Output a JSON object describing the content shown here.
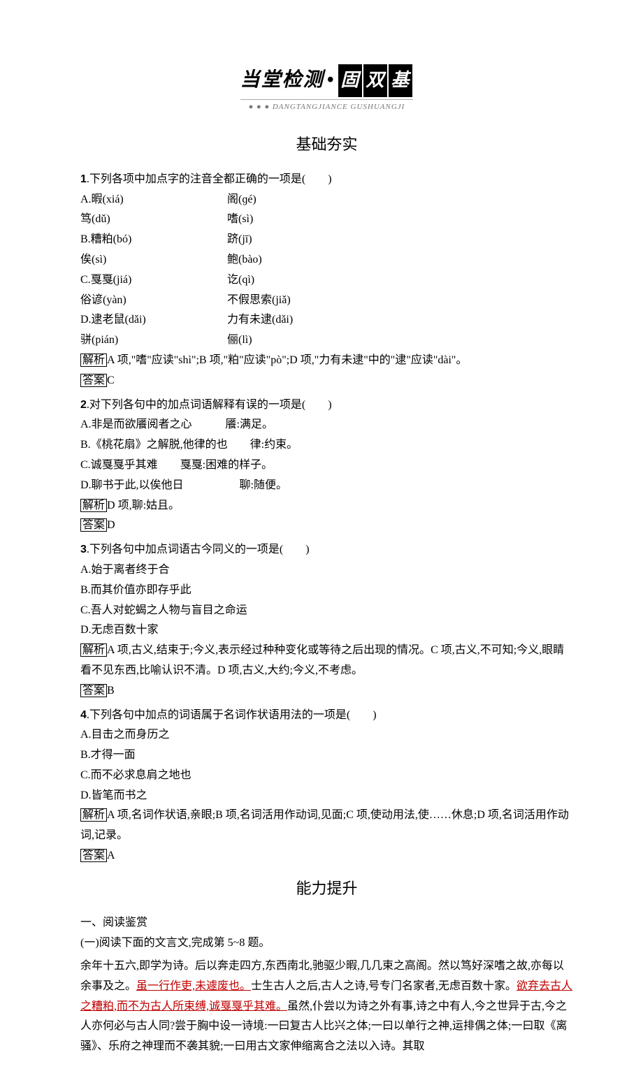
{
  "header": {
    "left": "当堂检测",
    "dot": "•",
    "box1": "固",
    "box2": "双",
    "box3": "基",
    "pinyin_prefix": "● ● ●",
    "pinyin": "DANGTANGJIANCE  GUSHUANGJI"
  },
  "section1_title": "基础夯实",
  "labels": {
    "jiexi": "解析",
    "daan": "答案"
  },
  "q1": {
    "stem": ".下列各项中加点字的注音全都正确的一项是(　　)",
    "num": "1",
    "opts": {
      "a1": "A.暇(xiá)",
      "a2": "阁(ɡé)",
      "a3": "笃(dǔ)",
      "a4": "嗜(sì)",
      "b1": "B.糟粕(bó)",
      "b2": "跻(jī)",
      "b3": "俟(sì)",
      "b4": "鲍(bào)",
      "c1": "C.戛戛(jiá)",
      "c2": "讫(qì)",
      "c3": "俗谚(yàn)",
      "c4": "不假思索(jiǎ)",
      "d1": "D.逮老鼠(dǎi)",
      "d2": "力有未逮(dǎi)",
      "d3": "骈(pián)",
      "d4": "俪(lì)"
    },
    "jiexi": "A 项,\"嗜\"应读\"shì\";B 项,\"粕\"应读\"pò\";D 项,\"力有未逮\"中的\"逮\"应读\"dài\"。",
    "daan": "C"
  },
  "q2": {
    "num": "2",
    "stem": ".对下列各句中的加点词语解释有误的一项是(　　)",
    "a": "A.非是而欲餍阅者之心　　　餍:满足。",
    "b": "B.《桃花扇》之解脱,他律的也　　律:约束。",
    "c": "C.诚戛戛乎其难　　戛戛:困难的样子。",
    "d": "D.聊书于此,以俟他日　　　　　聊:随便。",
    "jiexi": "D 项,聊:姑且。",
    "daan": "D"
  },
  "q3": {
    "num": "3",
    "stem": ".下列各句中加点词语古今同义的一项是(　　)",
    "a": "A.始于离者终于合",
    "b": "B.而其价值亦即存乎此",
    "c": "C.吾人对蛇蝎之人物与盲目之命运",
    "d": "D.无虑百数十家",
    "jiexi": "A 项,古义,结束于;今义,表示经过种种变化或等待之后出现的情况。C 项,古义,不可知;今义,眼睛看不见东西,比喻认识不清。D 项,古义,大约;今义,不考虑。",
    "daan": "B"
  },
  "q4": {
    "num": "4",
    "stem": ".下列各句中加点的词语属于名词作状语用法的一项是(　　)",
    "a": "A.目击之而身历之",
    "b": "B.才得一面",
    "c": "C.而不必求息肩之地也",
    "d": "D.皆笔而书之",
    "jiexi": "A 项,名词作状语,亲眼;B 项,名词活用作动词,见面;C 项,使动用法,使……休息;D 项,名词活用作动词,记录。",
    "daan": "A"
  },
  "section2_title": "能力提升",
  "reading": {
    "heading": "一、阅读鉴赏",
    "sub": "(一)阅读下面的文言文,完成第 5~8 题。",
    "p1a": "余年十五六,即学为诗。后以奔走四方,东西南北,驰驱少暇,几几束之高阁。然以笃好深嗜之故,亦每以余事及之。",
    "p1u1": "虽一行作吏,未遽废也。",
    "p1b": "士生古人之后,古人之诗,号专门名家者,无虑百数十家。",
    "p1u2": "欲弃去古人之糟粕,而不为古人所束缚,诚戛戛乎其难。",
    "p1c": "虽然,仆尝以为诗之外有事,诗之中有人,今之世异于古,今之人亦何必与古人同?尝于胸中设一诗境:一曰复古人比兴之体;一曰以单行之神,运排偶之体;一曰取《离骚》、乐府之神理而不袭其貌;一曰用古文家伸缩离合之法以入诗。其取"
  }
}
